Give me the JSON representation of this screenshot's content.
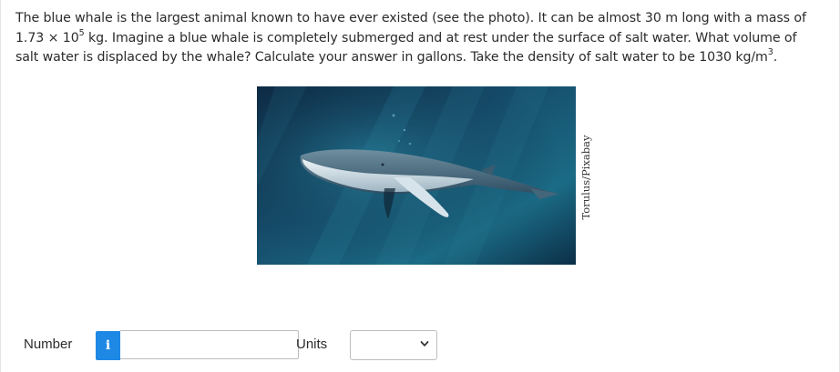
{
  "question": {
    "part1": "The blue whale is the largest animal known to have ever existed (see the photo). It can be almost 30 m long with a mass of 1.73 × 10",
    "exp1": "5",
    "part2": " kg. Imagine a blue whale is completely submerged and at rest under the surface of salt water. What volume of salt water is displaced by the whale? Calculate your answer in gallons. Take the density of salt water to be 1030 kg/m",
    "exp2": "3",
    "part3": "."
  },
  "photo": {
    "credit": "Torulus/Pixabay",
    "icon": "blue-whale-photo"
  },
  "answer": {
    "number_label": "Number",
    "info_icon_glyph": "i",
    "number_value": "",
    "units_label": "Units",
    "units_selected": ""
  },
  "colors": {
    "info_button": "#1e88e5",
    "water_dark": "#0b1e33",
    "water_light": "#1d6f8a"
  }
}
